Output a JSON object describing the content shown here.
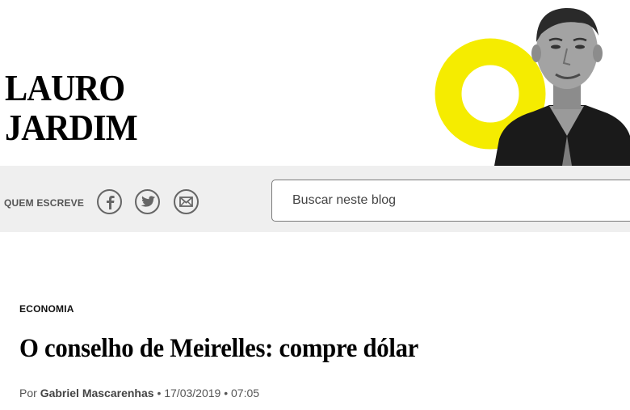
{
  "header": {
    "blog_title_line1": "LAURO",
    "blog_title_line2": "JARDIM"
  },
  "toolbar": {
    "quem_escreve_label": "QUEM ESCREVE",
    "social_icons": [
      "facebook-icon",
      "twitter-icon",
      "mail-icon"
    ],
    "search_placeholder": "Buscar neste blog"
  },
  "article": {
    "category": "ECONOMIA",
    "headline": "O conselho de Meirelles: compre dólar",
    "byline_prefix": "Por",
    "author": "Gabriel Mascarenhas",
    "date": "17/03/2019",
    "time": "07:05"
  },
  "colors": {
    "accent_yellow": "#f5ec00",
    "toolbar_background": "#efefef",
    "icon_gray": "#666666"
  }
}
